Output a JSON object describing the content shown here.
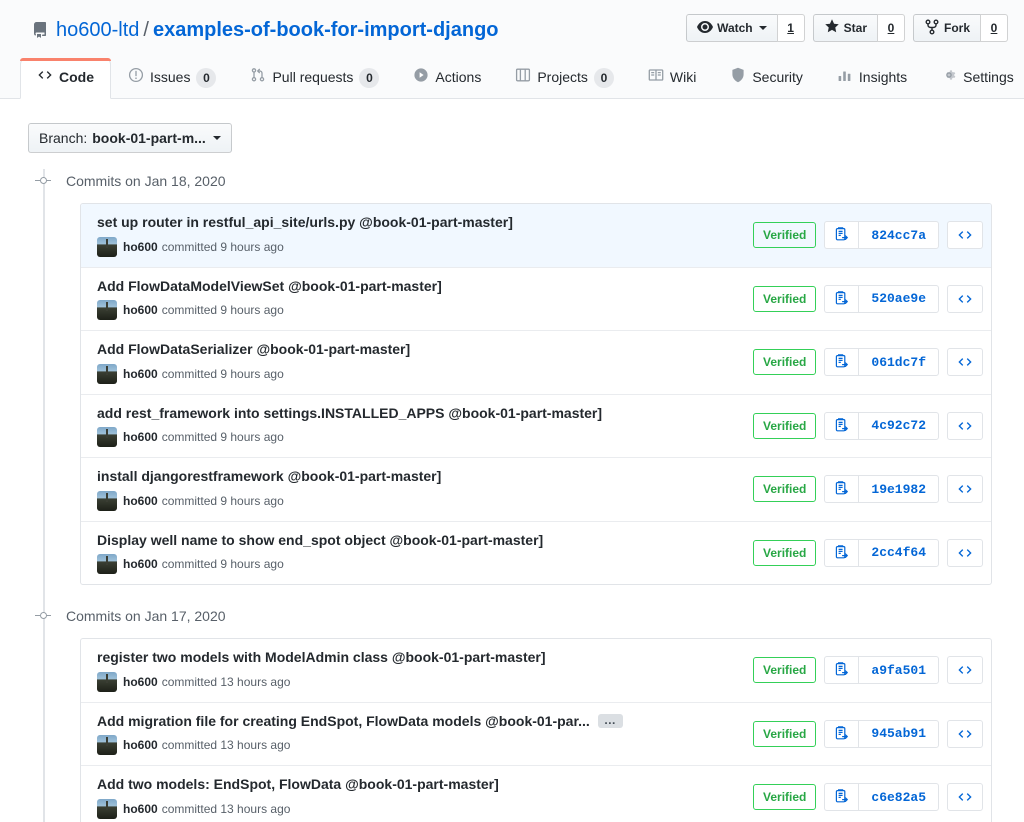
{
  "header": {
    "repo_icon": "repo-book-icon",
    "owner": "ho600-ltd",
    "separator": "/",
    "repo_name": "examples-of-book-for-import-django",
    "actions": [
      {
        "icon": "eye-icon",
        "label": "Watch",
        "count": "1",
        "has_caret": true
      },
      {
        "icon": "star-icon",
        "label": "Star",
        "count": "0",
        "has_caret": false
      },
      {
        "icon": "fork-icon",
        "label": "Fork",
        "count": "0",
        "has_caret": false
      }
    ]
  },
  "nav": {
    "tabs": [
      {
        "icon": "code-icon",
        "label": "Code",
        "count": null,
        "selected": true
      },
      {
        "icon": "issue-icon",
        "label": "Issues",
        "count": "0",
        "selected": false
      },
      {
        "icon": "pull-request-icon",
        "label": "Pull requests",
        "count": "0",
        "selected": false
      },
      {
        "icon": "play-icon",
        "label": "Actions",
        "count": null,
        "selected": false
      },
      {
        "icon": "project-icon",
        "label": "Projects",
        "count": "0",
        "selected": false
      },
      {
        "icon": "book-icon",
        "label": "Wiki",
        "count": null,
        "selected": false
      },
      {
        "icon": "shield-icon",
        "label": "Security",
        "count": null,
        "selected": false
      },
      {
        "icon": "graph-icon",
        "label": "Insights",
        "count": null,
        "selected": false
      },
      {
        "icon": "gear-icon",
        "label": "Settings",
        "count": null,
        "selected": false
      }
    ]
  },
  "branch_selector": {
    "prefix": "Branch:",
    "value": "book-01-part-m...",
    "caret_icon": "chevron-down-icon"
  },
  "commit_groups": [
    {
      "date_label": "Commits on Jan 18, 2020",
      "commits": [
        {
          "title": "set up router in restful_api_site/urls.py @book-01-part-master]",
          "truncated": false,
          "author": "ho600",
          "meta": "committed 9 hours ago",
          "verified": "Verified",
          "sha": "824cc7a",
          "highlight": true
        },
        {
          "title": "Add FlowDataModelViewSet @book-01-part-master]",
          "truncated": false,
          "author": "ho600",
          "meta": "committed 9 hours ago",
          "verified": "Verified",
          "sha": "520ae9e",
          "highlight": false
        },
        {
          "title": "Add FlowDataSerializer @book-01-part-master]",
          "truncated": false,
          "author": "ho600",
          "meta": "committed 9 hours ago",
          "verified": "Verified",
          "sha": "061dc7f",
          "highlight": false
        },
        {
          "title": "add rest_framework into settings.INSTALLED_APPS @book-01-part-master]",
          "truncated": false,
          "author": "ho600",
          "meta": "committed 9 hours ago",
          "verified": "Verified",
          "sha": "4c92c72",
          "highlight": false
        },
        {
          "title": "install djangorestframework @book-01-part-master]",
          "truncated": false,
          "author": "ho600",
          "meta": "committed 9 hours ago",
          "verified": "Verified",
          "sha": "19e1982",
          "highlight": false
        },
        {
          "title": "Display well name to show end_spot object @book-01-part-master]",
          "truncated": false,
          "author": "ho600",
          "meta": "committed 9 hours ago",
          "verified": "Verified",
          "sha": "2cc4f64",
          "highlight": false
        }
      ]
    },
    {
      "date_label": "Commits on Jan 17, 2020",
      "commits": [
        {
          "title": "register two models with ModelAdmin class @book-01-part-master]",
          "truncated": false,
          "author": "ho600",
          "meta": "committed 13 hours ago",
          "verified": "Verified",
          "sha": "a9fa501",
          "highlight": false
        },
        {
          "title": "Add migration file for creating EndSpot, FlowData models @book-01-par...",
          "truncated": true,
          "ellipsis_label": "…",
          "author": "ho600",
          "meta": "committed 13 hours ago",
          "verified": "Verified",
          "sha": "945ab91",
          "highlight": false
        },
        {
          "title": "Add two models: EndSpot, FlowData @book-01-part-master]",
          "truncated": false,
          "author": "ho600",
          "meta": "committed 13 hours ago",
          "verified": "Verified",
          "sha": "c6e82a5",
          "highlight": false
        }
      ]
    }
  ],
  "icons": {
    "copy": "clipboard-copy-icon",
    "browse": "code-brackets-icon"
  },
  "colors": {
    "link": "#0366d6",
    "verified": "#28a745",
    "tab_accent": "#f9826c",
    "highlight_row": "#f1f8ff",
    "border": "#e1e4e8"
  }
}
